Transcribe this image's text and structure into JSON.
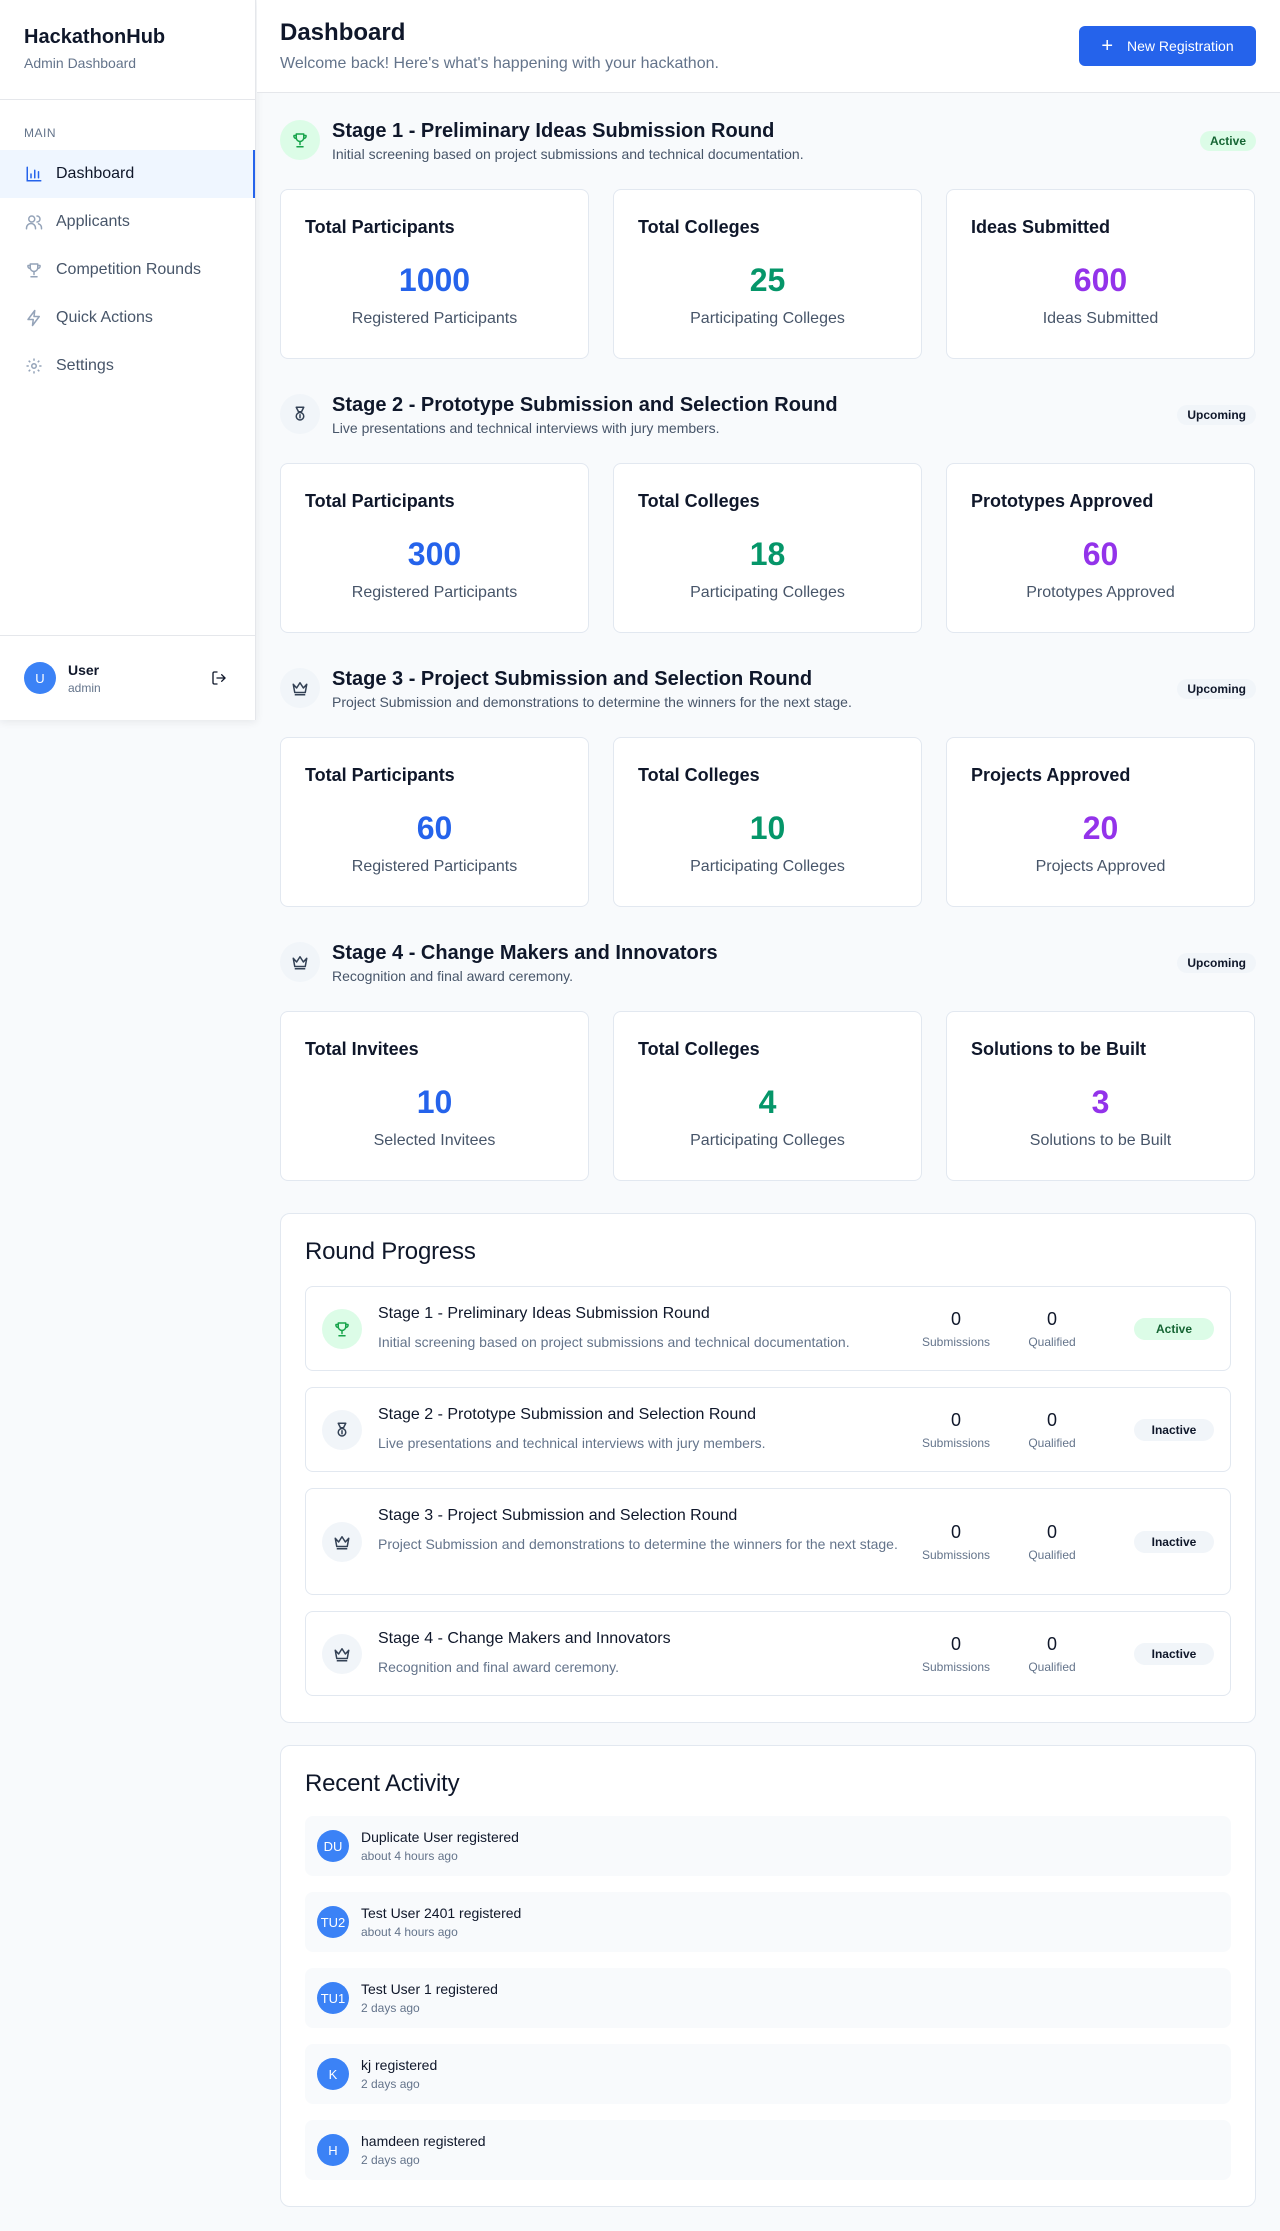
{
  "sidebar": {
    "brand_title": "HackathonHub",
    "brand_sub": "Admin Dashboard",
    "section": "MAIN",
    "items": [
      {
        "label": "Dashboard",
        "icon": "bar-chart-icon"
      },
      {
        "label": "Applicants",
        "icon": "users-icon"
      },
      {
        "label": "Competition Rounds",
        "icon": "trophy-icon"
      },
      {
        "label": "Quick Actions",
        "icon": "lightning-icon"
      },
      {
        "label": "Settings",
        "icon": "gear-icon"
      }
    ],
    "user": {
      "initial": "U",
      "name": "User",
      "role": "admin"
    }
  },
  "header": {
    "title": "Dashboard",
    "subtitle": "Welcome back! Here's what's happening with your hackathon.",
    "new_button": "New Registration"
  },
  "stages": [
    {
      "title": "Stage 1 - Preliminary Ideas Submission Round",
      "desc": "Initial screening based on project submissions and technical documentation.",
      "status": "Active",
      "cards": [
        {
          "label": "Total Participants",
          "value": "1000",
          "caption": "Registered Participants"
        },
        {
          "label": "Total Colleges",
          "value": "25",
          "caption": "Participating Colleges"
        },
        {
          "label": "Ideas Submitted",
          "value": "600",
          "caption": "Ideas Submitted"
        }
      ]
    },
    {
      "title": "Stage 2 - Prototype Submission and Selection Round",
      "desc": "Live presentations and technical interviews with jury members.",
      "status": "Upcoming",
      "cards": [
        {
          "label": "Total Participants",
          "value": "300",
          "caption": "Registered Participants"
        },
        {
          "label": "Total Colleges",
          "value": "18",
          "caption": "Participating Colleges"
        },
        {
          "label": "Prototypes Approved",
          "value": "60",
          "caption": "Prototypes Approved"
        }
      ]
    },
    {
      "title": "Stage 3 - Project Submission and Selection Round",
      "desc": "Project Submission and demonstrations to determine the winners for the next stage.",
      "status": "Upcoming",
      "cards": [
        {
          "label": "Total Participants",
          "value": "60",
          "caption": "Registered Participants"
        },
        {
          "label": "Total Colleges",
          "value": "10",
          "caption": "Participating Colleges"
        },
        {
          "label": "Projects Approved",
          "value": "20",
          "caption": "Projects Approved"
        }
      ]
    },
    {
      "title": "Stage 4 - Change Makers and Innovators",
      "desc": "Recognition and final award ceremony.",
      "status": "Upcoming",
      "cards": [
        {
          "label": "Total Invitees",
          "value": "10",
          "caption": "Selected Invitees"
        },
        {
          "label": "Total Colleges",
          "value": "4",
          "caption": "Participating Colleges"
        },
        {
          "label": "Solutions to be Built",
          "value": "3",
          "caption": "Solutions to be Built"
        }
      ]
    }
  ],
  "round_progress": {
    "title": "Round Progress",
    "submissions_label": "Submissions",
    "qualified_label": "Qualified",
    "items": [
      {
        "title": "Stage 1 - Preliminary Ideas Submission Round",
        "desc": "Initial screening based on project submissions and technical documentation.",
        "submissions": "0",
        "qualified": "0",
        "status": "Active"
      },
      {
        "title": "Stage 2 - Prototype Submission and Selection Round",
        "desc": "Live presentations and technical interviews with jury members.",
        "submissions": "0",
        "qualified": "0",
        "status": "Inactive"
      },
      {
        "title": "Stage 3 - Project Submission and Selection Round",
        "desc": "Project Submission and demonstrations to determine the winners for the next stage.",
        "submissions": "0",
        "qualified": "0",
        "status": "Inactive"
      },
      {
        "title": "Stage 4 - Change Makers and Innovators",
        "desc": "Recognition and final award ceremony.",
        "submissions": "0",
        "qualified": "0",
        "status": "Inactive"
      }
    ]
  },
  "recent_activity": {
    "title": "Recent Activity",
    "items": [
      {
        "initials": "DU",
        "text": "Duplicate User registered",
        "time": "about 4 hours ago"
      },
      {
        "initials": "TU2",
        "text": "Test User 2401 registered",
        "time": "about 4 hours ago"
      },
      {
        "initials": "TU1",
        "text": "Test User 1 registered",
        "time": "2 days ago"
      },
      {
        "initials": "K",
        "text": "kj registered",
        "time": "2 days ago"
      },
      {
        "initials": "H",
        "text": "hamdeen registered",
        "time": "2 days ago"
      }
    ]
  },
  "colors": {
    "accent": "#2563eb",
    "participants": "#2563eb",
    "colleges": "#059669",
    "approved": "#9333ea",
    "active_badge_bg": "#dcfce7"
  }
}
